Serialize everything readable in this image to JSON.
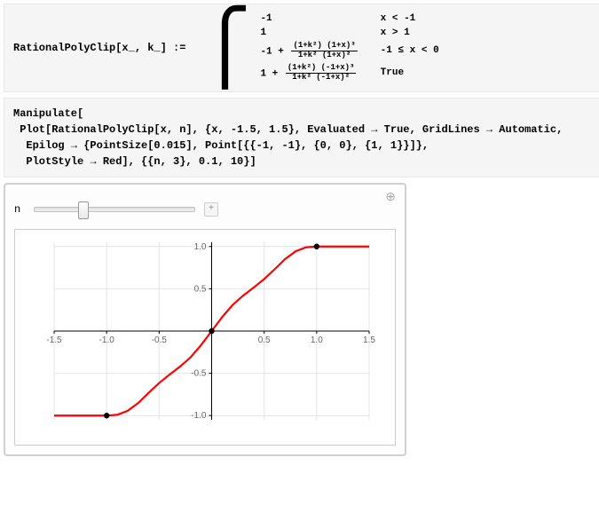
{
  "definition": {
    "lhs": "RationalPolyClip[x_, k_] := ",
    "pieces": [
      {
        "expr_text": "-1",
        "cond": "x < -1"
      },
      {
        "expr_text": "1",
        "cond": "x > 1"
      },
      {
        "expr_prefix": "-1 + ",
        "frac_num": "(1+k²) (1+x)³",
        "frac_den": "1+k² (1+x)²",
        "cond": "-1 ≤ x < 0"
      },
      {
        "expr_prefix": "1 + ",
        "frac_num": "(1+k²) (-1+x)³",
        "frac_den": "1+k² (-1+x)²",
        "cond": "True"
      }
    ]
  },
  "code": {
    "line1": "Manipulate[",
    "line2": " Plot[RationalPolyClip[x, n], {x, -1.5, 1.5}, Evaluated → True, GridLines → Automatic,",
    "line3": "  Epilog → {PointSize[0.015], Point[{{-1, -1}, {0, 0}, {1, 1}}]},",
    "line4": "  PlotStyle → Red], {{n, 3}, 0.1, 10}]"
  },
  "manipulate": {
    "var_label": "n",
    "slider_min": 0.1,
    "slider_max": 10,
    "slider_value": 3
  },
  "chart_data": {
    "type": "line",
    "title": "",
    "xlabel": "",
    "ylabel": "",
    "xlim": [
      -1.5,
      1.5
    ],
    "ylim": [
      -1.05,
      1.05
    ],
    "x_ticks": [
      -1.5,
      -1.0,
      -0.5,
      0.5,
      1.0,
      1.5
    ],
    "y_ticks": [
      -1.0,
      -0.5,
      0.5,
      1.0
    ],
    "gridlines": true,
    "plot_color": "#ff0000",
    "series": [
      {
        "name": "RationalPolyClip[x, 3]",
        "x": [
          -1.5,
          -1.3,
          -1.1,
          -1.0,
          -0.9,
          -0.8,
          -0.7,
          -0.6,
          -0.5,
          -0.4,
          -0.3,
          -0.2,
          -0.1,
          0.0,
          0.1,
          0.2,
          0.3,
          0.4,
          0.5,
          0.6,
          0.7,
          0.8,
          0.9,
          1.0,
          1.1,
          1.3,
          1.5
        ],
        "y": [
          -1.0,
          -1.0,
          -1.0,
          -1.0,
          -0.991,
          -0.944,
          -0.852,
          -0.731,
          -0.615,
          -0.514,
          -0.419,
          -0.31,
          -0.165,
          0.0,
          0.165,
          0.31,
          0.419,
          0.514,
          0.615,
          0.731,
          0.852,
          0.944,
          0.991,
          1.0,
          1.0,
          1.0,
          1.0
        ]
      }
    ],
    "epilog_points": [
      {
        "x": -1,
        "y": -1
      },
      {
        "x": 0,
        "y": 0
      },
      {
        "x": 1,
        "y": 1
      }
    ]
  }
}
